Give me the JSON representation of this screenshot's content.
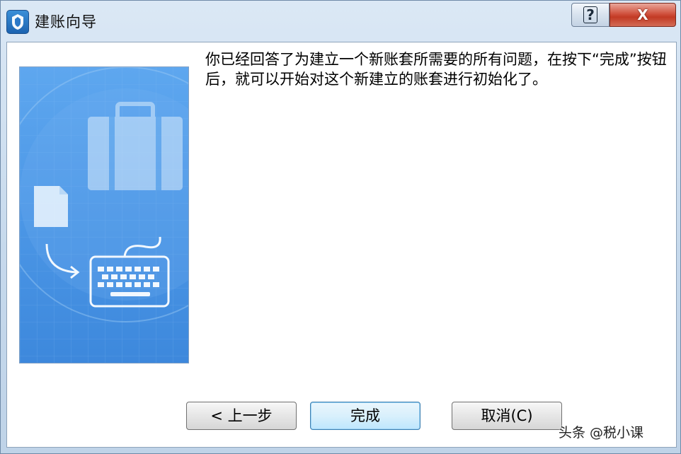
{
  "window": {
    "title": "建账向导",
    "help_label": "?",
    "close_label": "X"
  },
  "wizard": {
    "message": "你已经回答了为建立一个新账套所需要的所有问题，在按下“完成”按钮后，就可以开始对这个新建立的账套进行初始化了。"
  },
  "buttons": {
    "back": "< 上一步",
    "finish": "完成",
    "cancel": "取消(C)"
  },
  "watermark": "头条 @税小课",
  "colors": {
    "close_button": "#c23a24",
    "wizard_panel": "#4c97e6",
    "finish_focus": "#3c7fb1"
  }
}
